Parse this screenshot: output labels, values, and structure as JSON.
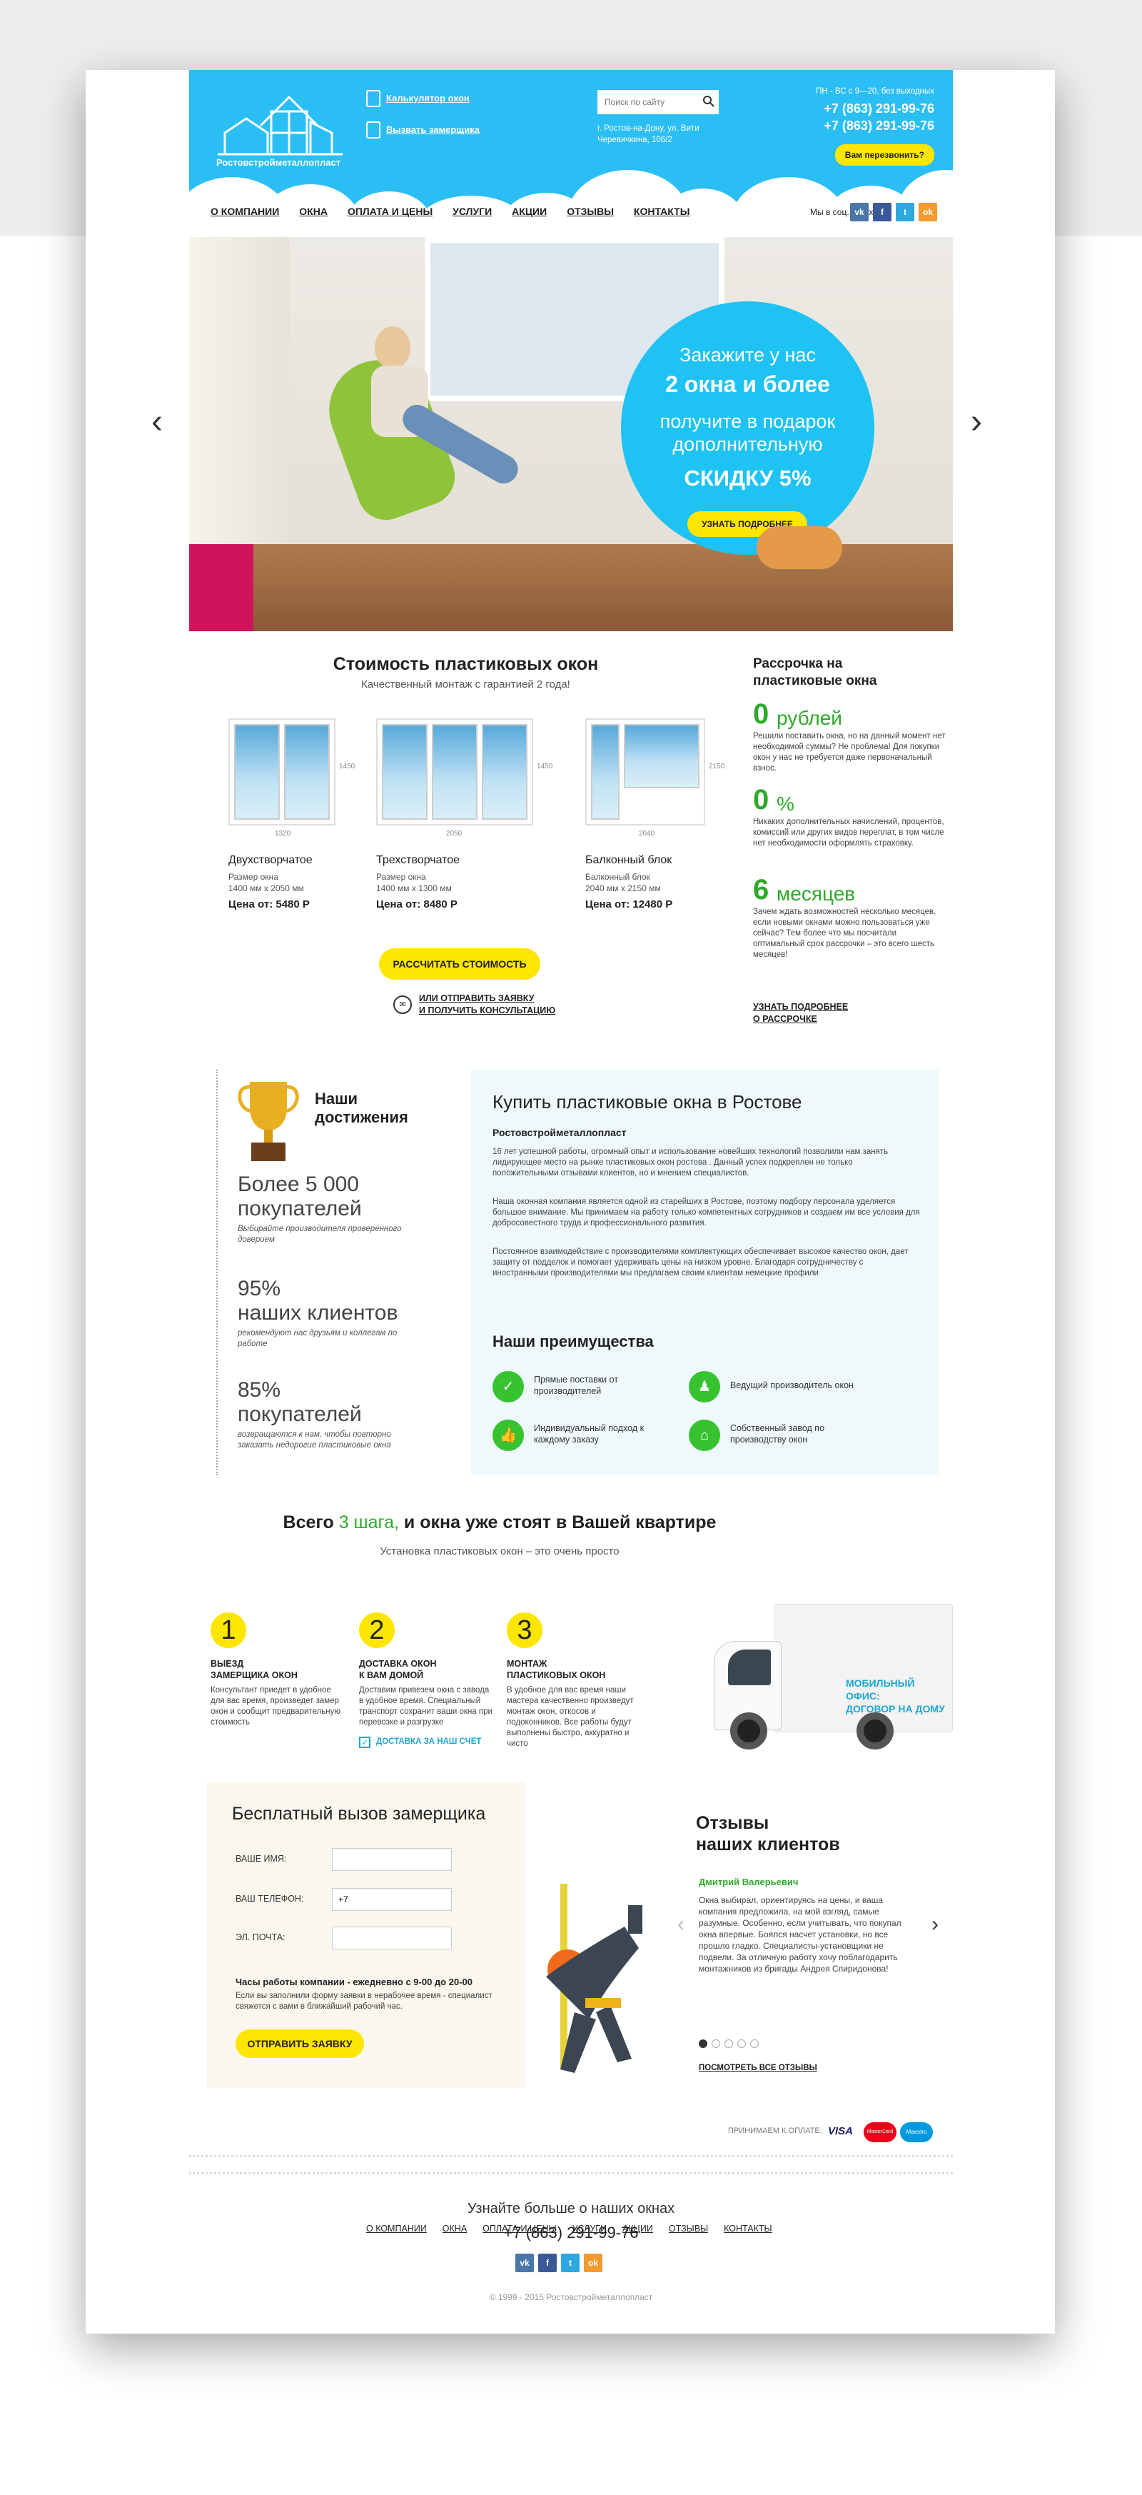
{
  "header": {
    "company": "Ростовстройметаллопласт",
    "link_calc": "Калькулятор окон",
    "link_measurer": "Вызвать замерщика",
    "search_placeholder": "Поиск по сайту",
    "address": "г. Ростов-на-Дону, ул. Вити Черевичкина, 106/2",
    "hours": "ПН - ВС с 9—20, без выходных",
    "phone1": "+7 (863) 291-99-76",
    "phone2": "+7 (863) 291-99-76",
    "callback": "Вам перезвонить?"
  },
  "nav": {
    "items": [
      "О КОМПАНИИ",
      "ОКНА",
      "ОПЛАТА И ЦЕНЫ",
      "УСЛУГИ",
      "АКЦИИ",
      "ОТЗЫВЫ",
      "КОНТАКТЫ"
    ],
    "social_label": "Мы в соц. сетях:",
    "social": [
      "vk",
      "f",
      "t",
      "ok"
    ]
  },
  "hero": {
    "line1": "Закажите у нас",
    "line2": "2 окна и более",
    "line3": "получите в подарок",
    "line4": "дополнительную",
    "line5": "СКИДКУ 5%",
    "button": "УЗНАТЬ ПОДРОБНЕЕ"
  },
  "prices": {
    "title": "Стоимость пластиковых окон",
    "subtitle": "Качественный монтаж с гарантией 2 года!",
    "windows": [
      {
        "name": "Двухстворчатое",
        "size_label": "Размер окна",
        "size": "1400 мм x 2050 мм",
        "price": "Цена от: 5480 Р",
        "w": "1320",
        "h": "1450"
      },
      {
        "name": "Трехстворчатое",
        "size_label": "Размер окна",
        "size": "1400 мм x 1300 мм",
        "price": "Цена от: 8480 Р",
        "w": "2050",
        "h": "1450"
      },
      {
        "name": "Балконный блок",
        "size_label": "Балконный блок",
        "size": "2040 мм x 2150 мм",
        "price": "Цена от: 12480 Р",
        "w": "2040",
        "h": "2150"
      }
    ],
    "calc_button": "РАССЧИТАТЬ СТОИМОСТЬ",
    "or_link1": "ИЛИ ОТПРАВИТЬ ЗАЯВКУ",
    "or_link2": "И ПОЛУЧИТЬ КОНСУЛЬТАЦИЮ"
  },
  "credit": {
    "title1": "Рассрочка на",
    "title2": "пластиковые окна",
    "items": [
      {
        "num": "0",
        "unit": "рублей",
        "text": "Решили поставить окна, но на данный момент нет необходимой суммы? Не проблема! Для покупки окон у нас не требуется даже первоначальный взнос."
      },
      {
        "num": "0",
        "unit": "%",
        "text": "Никаких дополнительных начислений, процентов, комиссий или других видов переплат, в том числе нет необходимости оформлять страховку."
      },
      {
        "num": "6",
        "unit": "месяцев",
        "text": "Зачем ждать возможностей несколько месяцев, если новыми окнами можно пользоваться уже сейчас? Тем более что мы посчитали оптимальный срок рассрочки – это всего шесть месяцев!"
      }
    ],
    "link1": "УЗНАТЬ ПОДРОБНЕЕ",
    "link2": "О РАССРОЧКЕ"
  },
  "achievements": {
    "title1": "Наши",
    "title2": "достижения",
    "items": [
      {
        "l1": "Более 5 000",
        "l2": "покупателей",
        "note": "Выбирайте производителя проверенного доверием"
      },
      {
        "l1": "95%",
        "l2": "наших клиентов",
        "note": "рекомендуют нас друзьям и коллегам по работе"
      },
      {
        "l1": "85%",
        "l2": "покупателей",
        "note": "возвращаются к нам, чтобы повторно заказать недорогие пластиковые окна"
      }
    ]
  },
  "about": {
    "title": "Купить пластиковые окна в Ростове",
    "firm": "Ростовстройметаллопласт",
    "p1": "16 лет успешной работы, огромный опыт и использование новейших технологий позволили нам занять лидирующее место на рынке пластиковых окон ростова . Данный успех подкреплен не только положительными отзывами клиентов, но и мнением специалистов.",
    "p2": "Наша оконная компания является одной из старейших в Ростове, поэтому подбору персонала уделяется большое внимание. Мы принимаем на работу только компетентных сотрудников и создаем им все условия для добросовестного труда и профессионального развития.",
    "p3": "Постоянное взаимодействие с производителями комплектующих обеспечивает высокое качество окон, дает защиту от подделок и помогает удерживать цены на низком уровне. Благодаря сотрудничеству с иностранными производителями мы предлагаем своим клиентам немецкие профили",
    "adv_title": "Наши преимущества",
    "adv": [
      "Прямые поставки от производителей",
      "Ведущий производитель окон",
      "Индивидуальный подход к каждому заказу",
      "Собственный завод по производству окон"
    ]
  },
  "steps": {
    "title_pre": "Всего",
    "title_green": "3 шага,",
    "title_post": "и окна уже стоят  в Вашей квартире",
    "subtitle": "Установка пластиковых окон – это очень просто",
    "items": [
      {
        "n": "1",
        "h1": "ВЫЕЗД",
        "h2": "ЗАМЕРЩИКА ОКОН",
        "text": "Консультант приедет в удобное для вас время, произведет замер окон и сообщит предварительную стоимость"
      },
      {
        "n": "2",
        "h1": "ДОСТАВКА ОКОН",
        "h2": "К ВАМ ДОМОЙ",
        "text": "Доставим привезем окна с завода в удобное время. Специальный транспорт сохранит ваши окна при перевозке и разгрузке"
      },
      {
        "n": "3",
        "h1": "МОНТАЖ",
        "h2": "ПЛАСТИКОВЫХ ОКОН",
        "text": "В удобное для вас время наши мастера качественно произведут монтаж окон, откосов и подоконников. Все работы будут выполнены быстро, аккуратно и чисто"
      }
    ],
    "delivery_note": "ДОСТАВКА ЗА НАШ СЧЕТ",
    "truck_text1": "МОБИЛЬНЫЙ ОФИС:",
    "truck_text2": "ДОГОВОР НА ДОМУ"
  },
  "form": {
    "title": "Бесплатный вызов замерщика",
    "name_label": "ВАШЕ ИМЯ:",
    "phone_label": "ВАШ ТЕЛЕФОН:",
    "phone_value": "+7",
    "email_label": "ЭЛ. ПОЧТА:",
    "hours_title": "Часы работы компании  - ежедневно с 9-00 до 20-00",
    "hours_text": "Если вы заполнили форму заявки в нерабочее время - специалист свяжется  с вами в ближайший рабочий час.",
    "submit": "ОТПРАВИТЬ ЗАЯВКУ"
  },
  "reviews": {
    "title1": "Отзывы",
    "title2": "наших клиентов",
    "name": "Дмитрий Валерьевич",
    "text": "Окна выбирал, ориентируясь на цены, и ваша компания предложила, на мой взгляд, самые разумные. Особенно, если учитывать, что покупал окна впервые. Боялся насчет установки, но все прошло гладко. Специалисты-установщики не подвели. За отличную работу хочу поблагодарить монтажников из бригады Андрея Спиридонова!",
    "all_link": "ПОСМОТРЕТЬ ВСЕ ОТЗЫВЫ"
  },
  "footer": {
    "pay_label": "ПРИНИМАЕМ К ОПЛАТЕ:",
    "pay": [
      "VISA",
      "MasterCard",
      "Maestro"
    ],
    "nav": [
      "О КОМПАНИИ",
      "ОКНА",
      "ОПЛАТА И ЦЕНЫ",
      "УСЛУГИ",
      "АКЦИИ",
      "ОТЗЫВЫ",
      "КОНТАКТЫ"
    ],
    "cta": "Узнайте больше о наших окнах",
    "phone": "+7 (863) 291-99-76",
    "copyright": "© 1999 - 2015 Ростовстройметаллопласт"
  },
  "colors": {
    "blue": "#2bbef5",
    "yellow": "#ffe600",
    "green": "#2eaa2a"
  }
}
